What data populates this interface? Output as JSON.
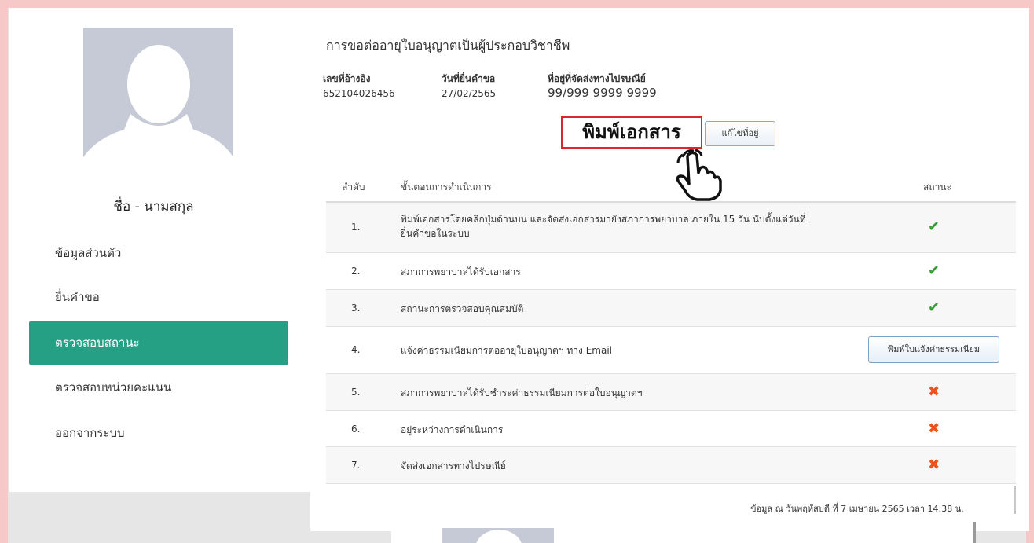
{
  "sidebar": {
    "name_label": "ชื่อ - นามสกุล",
    "items": [
      {
        "label": "ข้อมูลส่วนตัว",
        "active": false
      },
      {
        "label": "ยื่นคำขอ",
        "active": false
      },
      {
        "label": "ตรวจสอบสถานะ",
        "active": true
      },
      {
        "label": "ตรวจสอบหน่วยคะแนน",
        "active": false
      },
      {
        "label": "ออกจากระบบ",
        "active": false
      }
    ]
  },
  "main": {
    "title": "การขอต่ออายุใบอนุญาตเป็นผู้ประกอบวิชาชีพ",
    "ref_label": "เลขที่อ้างอิง",
    "ref_value": "652104026456",
    "date_label": "วันที่ยื่นคำขอ",
    "date_value": "27/02/2565",
    "address_label": "ที่อยู่ที่จัดส่งทางไปรษณีย์",
    "address_value": "99/999 9999 9999",
    "print_label": "พิมพ์เอกสาร",
    "edit_address_label": "แก้ไขที่อยู่"
  },
  "table": {
    "headers": {
      "no": "ลำดับ",
      "step": "ขั้นตอนการดำเนินการ",
      "status": "สถานะ"
    },
    "rows": [
      {
        "no": "1.",
        "step": "พิมพ์เอกสารโดยคลิกปุ่มด้านบน และจัดส่งเอกสารมายังสภาการพยาบาล ภายใน 15 วัน นับตั้งแต่วันที่",
        "step2": "ยื่นคำขอในระบบ",
        "status": "✔"
      },
      {
        "no": "2.",
        "step": "สภาการพยาบาลได้รับเอกสาร",
        "status": "✔"
      },
      {
        "no": "3.",
        "step": "สถานะการตรวจสอบคุณสมบัติ",
        "status": "✔"
      },
      {
        "no": "4.",
        "step": "แจ้งค่าธรรมเนียมการต่ออายุใบอนุญาตฯ ทาง Email",
        "button": "พิมพ์ใบแจ้งค่าธรรมเนียม"
      },
      {
        "no": "5.",
        "step": "สภาการพยาบาลได้รับชำระค่าธรรมเนียมการต่อใบอนุญาตฯ",
        "status": "✖"
      },
      {
        "no": "6.",
        "step": "อยู่ระหว่างการดำเนินการ",
        "status": "✖"
      },
      {
        "no": "7.",
        "step": "จัดส่งเอกสารทางไปรษณีย์",
        "status": "✖"
      }
    ]
  },
  "footer_note": "ข้อมูล ณ วันพฤหัสบดี ที่ 7 เมษายน 2565 เวลา 14:38 น.",
  "colors": {
    "accent": "#26a085",
    "ok": "#3a9a3a",
    "bad": "#e8531e",
    "highlight": "#e0252c"
  },
  "icons": {
    "pointer": "hand-pointer-icon",
    "ok": "check-icon",
    "bad": "cross-icon",
    "avatar": "user-avatar-icon"
  }
}
